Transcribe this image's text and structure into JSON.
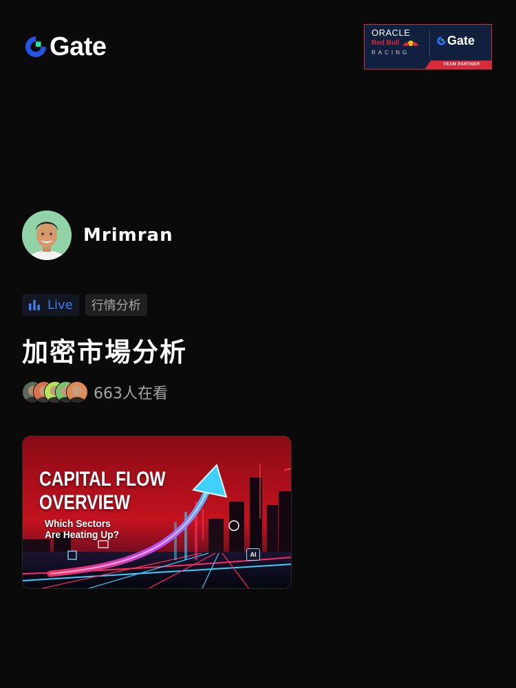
{
  "brand": {
    "name": "Gate",
    "accent": "#2354e6",
    "accent2": "#17e7a0"
  },
  "partner": {
    "oracle": "ORACLE",
    "redbull": "Red Bull",
    "racing": "RACING",
    "gate": "Gate",
    "strip": "TEAM PARTNER"
  },
  "host": {
    "name": "Mrimran",
    "avatar_icon": "host-avatar"
  },
  "tags": {
    "live": "Live",
    "category": "行情分析"
  },
  "stream": {
    "title": "加密市場分析"
  },
  "viewers": {
    "count_label": "663人在看",
    "avatars": 5
  },
  "thumbnail": {
    "title_line1": "CAPITAL FLOW",
    "title_line2": "OVERVIEW",
    "sub_line1": "Which Sectors",
    "sub_line2": "Are Heating Up?",
    "badge": "AI"
  },
  "colors": {
    "background": "#0a0a0a",
    "live_blue": "#3f7cf0",
    "muted": "#a6a6a6"
  }
}
